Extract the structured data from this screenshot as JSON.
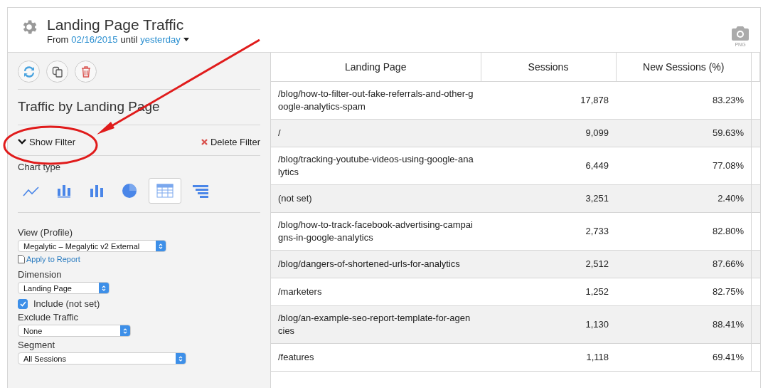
{
  "report": {
    "title": "Landing Page Traffic",
    "date_range": {
      "from_label": "From",
      "start": "02/16/2015",
      "until_label": "until",
      "end": "yesterday"
    },
    "export_label": "PNG"
  },
  "sidebar": {
    "widget_title": "Traffic by Landing Page",
    "show_filter": "Show Filter",
    "delete_filter": "Delete Filter",
    "chart_type_label": "Chart type",
    "chart_types": [
      {
        "kind": "line",
        "selected": false
      },
      {
        "kind": "grouped-bar",
        "selected": false
      },
      {
        "kind": "bar",
        "selected": false
      },
      {
        "kind": "pie",
        "selected": false
      },
      {
        "kind": "table",
        "selected": true
      },
      {
        "kind": "funnel",
        "selected": false
      }
    ],
    "fields": [
      {
        "kind": "select",
        "label": "View (Profile)",
        "value": "Megalytic – Megalytic v2 External"
      },
      {
        "kind": "link",
        "label": "Apply to Report"
      },
      {
        "kind": "select",
        "label": "Dimension",
        "value": "Landing Page"
      },
      {
        "kind": "checkbox",
        "label": "Include (not set)",
        "checked": true
      },
      {
        "kind": "select",
        "label": "Exclude Traffic",
        "value": "None"
      },
      {
        "kind": "select",
        "label": "Segment",
        "value": "All Sessions"
      }
    ]
  },
  "table": {
    "columns": [
      "Landing Page",
      "Sessions",
      "New Sessions (%)"
    ],
    "rows": [
      [
        "/blog/how-to-filter-out-fake-referrals-and-other-google-analytics-spam",
        "17,878",
        "83.23%"
      ],
      [
        "/",
        "9,099",
        "59.63%"
      ],
      [
        "/blog/tracking-youtube-videos-using-google-analytics",
        "6,449",
        "77.08%"
      ],
      [
        "(not set)",
        "3,251",
        "2.40%"
      ],
      [
        "/blog/how-to-track-facebook-advertising-campaigns-in-google-analytics",
        "2,733",
        "82.80%"
      ],
      [
        "/blog/dangers-of-shortened-urls-for-analytics",
        "2,512",
        "87.66%"
      ],
      [
        "/marketers",
        "1,252",
        "82.75%"
      ],
      [
        "/blog/an-example-seo-report-template-for-agencies",
        "1,130",
        "88.41%"
      ],
      [
        "/features",
        "1,118",
        "69.41%"
      ]
    ]
  }
}
